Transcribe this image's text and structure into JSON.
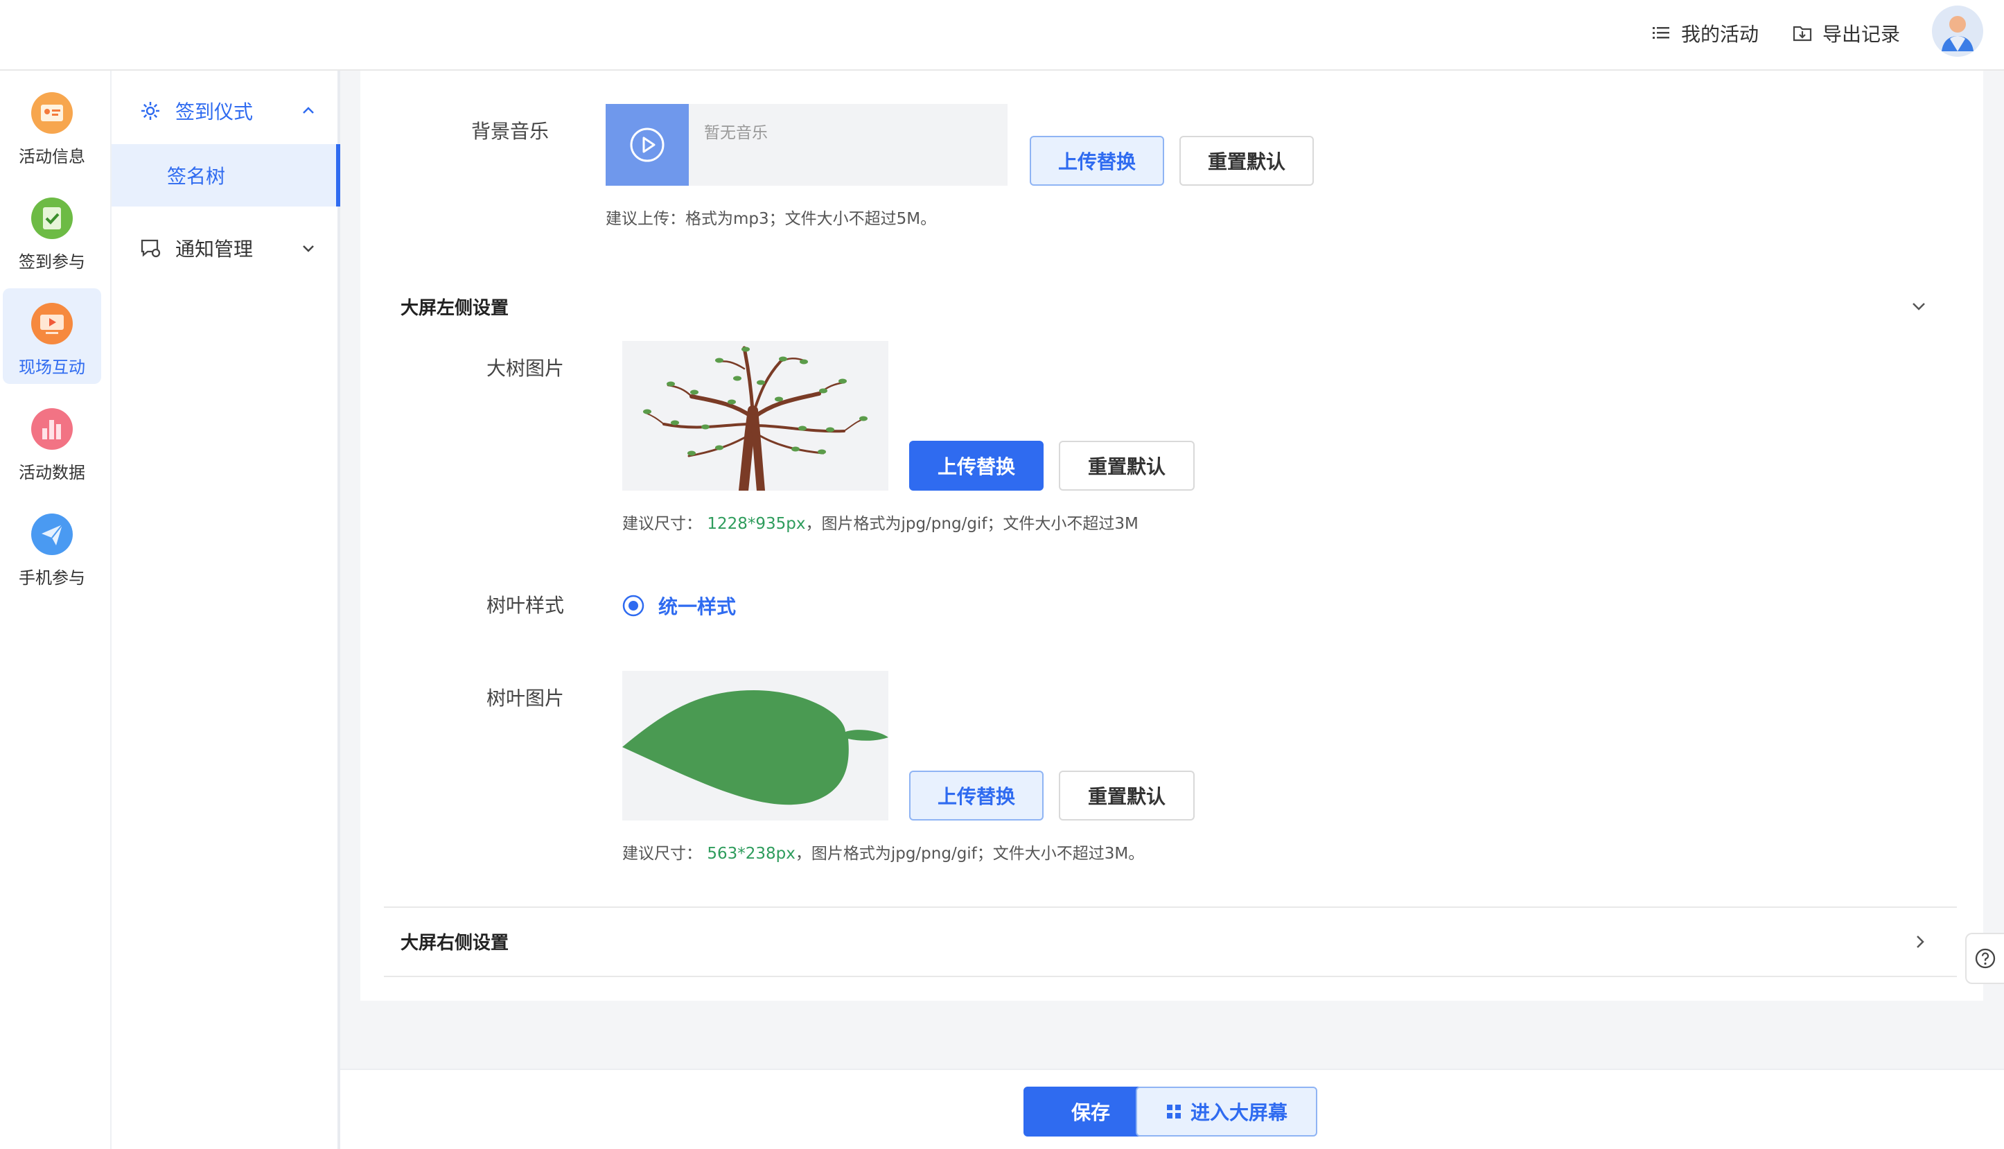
{
  "header": {
    "my_activities": "我的活动",
    "export_records": "导出记录"
  },
  "primary_nav": [
    {
      "label": "活动信息",
      "icon": "activity-info-icon",
      "color": "#f5a04a"
    },
    {
      "label": "签到参与",
      "icon": "checkin-icon",
      "color": "#4caf50"
    },
    {
      "label": "现场互动",
      "icon": "live-interaction-icon",
      "color": "#f47b3c",
      "active": true
    },
    {
      "label": "活动数据",
      "icon": "activity-data-icon",
      "color": "#f06a7a"
    },
    {
      "label": "手机参与",
      "icon": "mobile-participation-icon",
      "color": "#3b8ff0"
    }
  ],
  "secondary_nav": {
    "group1": "签到仪式",
    "group1_sub": "签名树",
    "group2": "通知管理"
  },
  "music": {
    "label": "背景音乐",
    "placeholder": "暂无音乐",
    "upload": "上传替换",
    "reset": "重置默认",
    "hint": "建议上传：格式为mp3；文件大小不超过5M。"
  },
  "left_section": {
    "title": "大屏左侧设置",
    "tree_label": "大树图片",
    "tree_upload": "上传替换",
    "tree_reset": "重置默认",
    "tree_hint_prefix": "建议尺寸：",
    "tree_hint_size": "1228*935px",
    "tree_hint_suffix": "，图片格式为jpg/png/gif；文件大小不超过3M",
    "leaf_style_label": "树叶样式",
    "leaf_style_option": "统一样式",
    "leaf_label": "树叶图片",
    "leaf_upload": "上传替换",
    "leaf_reset": "重置默认",
    "leaf_hint_prefix": "建议尺寸：",
    "leaf_hint_size": "563*238px",
    "leaf_hint_suffix": "，图片格式为jpg/png/gif；文件大小不超过3M。"
  },
  "right_section": {
    "title": "大屏右侧设置"
  },
  "footer": {
    "save": "保存",
    "enter_screen": "进入大屏幕"
  },
  "colors": {
    "primary": "#2f6bf0",
    "hint_green": "#2e9c5c",
    "leaf_green": "#4a9a52",
    "trunk_brown": "#7a3b26"
  }
}
